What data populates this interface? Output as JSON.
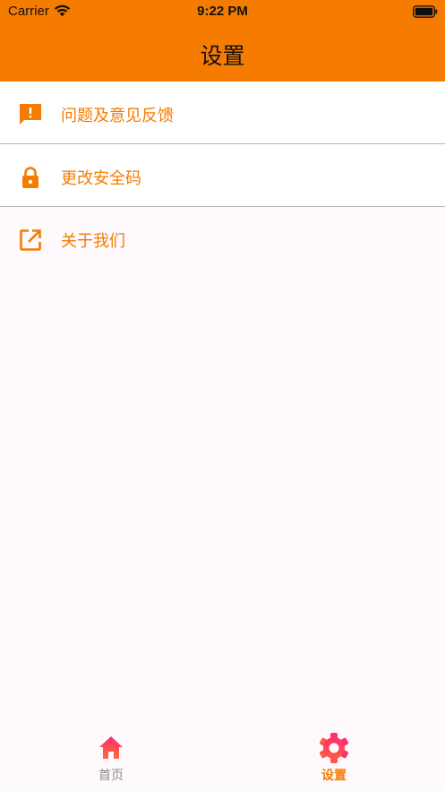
{
  "status_bar": {
    "carrier": "Carrier",
    "time": "9:22 PM"
  },
  "header": {
    "title": "设置"
  },
  "settings_list": [
    {
      "label": "问题及意见反馈",
      "icon": "feedback-icon"
    },
    {
      "label": "更改安全码",
      "icon": "lock-icon"
    },
    {
      "label": "关于我们",
      "icon": "open-in-new-icon"
    }
  ],
  "tabbar": {
    "tabs": [
      {
        "label": "首页",
        "icon": "home-icon",
        "active": false
      },
      {
        "label": "设置",
        "icon": "gear-icon",
        "active": true
      }
    ]
  },
  "colors": {
    "accent": "#f57c00",
    "tab_icon_gradient_start": "#ff2d6f",
    "tab_icon_gradient_end": "#ff6a3d",
    "inactive_tab_label": "#8a8a8a"
  }
}
